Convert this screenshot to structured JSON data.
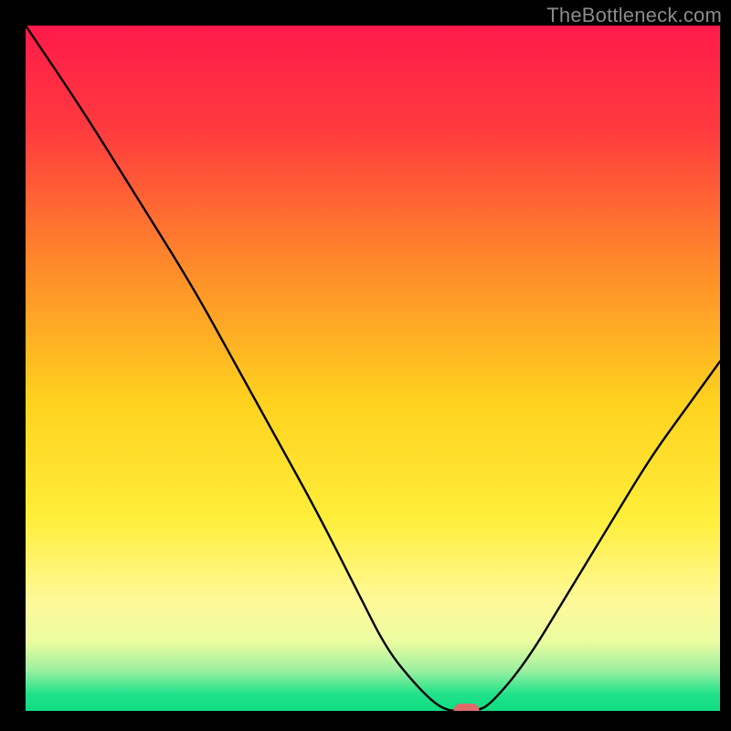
{
  "watermark": "TheBottleneck.com",
  "chart_data": {
    "type": "line",
    "title": "",
    "xlabel": "",
    "ylabel": "",
    "xlim": [
      0,
      100
    ],
    "ylim": [
      0,
      100
    ],
    "background_gradient_stops": [
      {
        "offset": 0.0,
        "color": "#ff1a4a"
      },
      {
        "offset": 0.15,
        "color": "#ff3a3f"
      },
      {
        "offset": 0.35,
        "color": "#ff8a2a"
      },
      {
        "offset": 0.55,
        "color": "#ffd21f"
      },
      {
        "offset": 0.72,
        "color": "#ffee3a"
      },
      {
        "offset": 0.84,
        "color": "#fff99a"
      },
      {
        "offset": 0.9,
        "color": "#eafca0"
      },
      {
        "offset": 0.94,
        "color": "#9ef0a0"
      },
      {
        "offset": 0.975,
        "color": "#22e28b"
      },
      {
        "offset": 1.0,
        "color": "#0fdc82"
      }
    ],
    "series": [
      {
        "name": "bottleneck-curve",
        "x": [
          0,
          8,
          16,
          24,
          30,
          36,
          42,
          48,
          52,
          56,
          59,
          61,
          63,
          65,
          67,
          72,
          78,
          84,
          90,
          95,
          100
        ],
        "y": [
          100,
          88,
          75,
          62,
          51,
          40,
          29,
          17,
          9,
          4,
          1,
          0,
          0,
          0,
          1,
          7,
          17,
          27,
          37,
          44,
          51
        ]
      }
    ],
    "marker": {
      "x": 63.5,
      "y": 0,
      "color": "#e06a6a",
      "label": ""
    }
  }
}
